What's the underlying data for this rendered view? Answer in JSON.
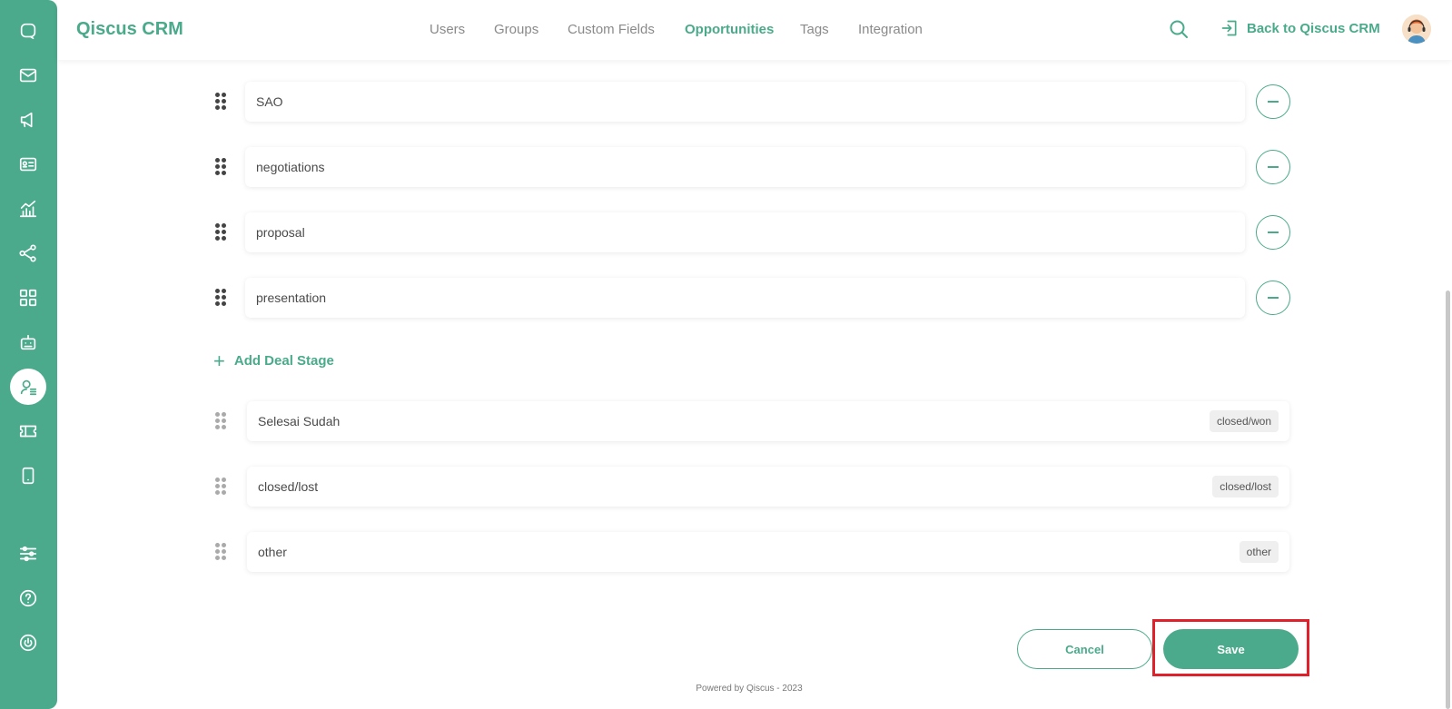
{
  "app": {
    "brand": "Qiscus CRM",
    "accent_color": "#4aaa8b"
  },
  "sidebar": {
    "icons": [
      "chat-icon",
      "mail-icon",
      "megaphone-icon",
      "contact-card-icon",
      "analytics-icon",
      "share-nodes-icon",
      "apps-grid-icon",
      "bot-icon",
      "crm-agent-icon",
      "ticket-icon",
      "mobile-icon",
      "settings-sliders-icon",
      "help-icon",
      "power-icon"
    ],
    "active": "crm-agent-icon"
  },
  "nav": {
    "items": [
      "Users",
      "Groups",
      "Custom Fields",
      "Opportunities",
      "Tags",
      "Integration"
    ],
    "active": "Opportunities",
    "back_label": "Back to Qiscus CRM"
  },
  "stages": [
    {
      "value": "SAO"
    },
    {
      "value": "negotiations"
    },
    {
      "value": "proposal"
    },
    {
      "value": "presentation"
    }
  ],
  "add_stage_label": "Add Deal Stage",
  "fixed_stages": [
    {
      "value": "Selesai Sudah",
      "tag": "closed/won"
    },
    {
      "value": "closed/lost",
      "tag": "closed/lost"
    },
    {
      "value": "other",
      "tag": "other"
    }
  ],
  "actions": {
    "cancel_label": "Cancel",
    "save_label": "Save"
  },
  "footer": "Powered by Qiscus - 2023"
}
